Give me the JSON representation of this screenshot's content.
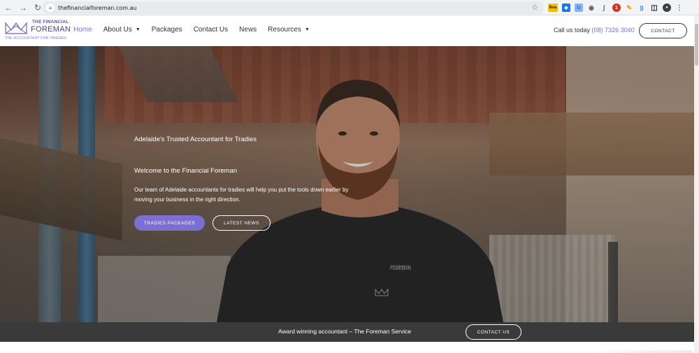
{
  "browser": {
    "url": "thefinancialforeman.com.au",
    "extensions": [
      "beta-icon",
      "tag-icon",
      "translate-icon",
      "camera-icon",
      "quill-icon",
      "red-badge-icon",
      "pencil-icon",
      "wave-icon",
      "puzzle-icon",
      "profile-avatar",
      "kebab-menu-icon"
    ],
    "beta_label": "Beta"
  },
  "logo": {
    "the": "THE FINANCIAL",
    "name": "FOREMAN",
    "tagline": "THE ACCOUNTANT FOR TRADIES"
  },
  "nav": {
    "items": [
      {
        "label": "Home",
        "active": true,
        "dropdown": false
      },
      {
        "label": "About Us",
        "active": false,
        "dropdown": true
      },
      {
        "label": "Packages",
        "active": false,
        "dropdown": false
      },
      {
        "label": "Contact Us",
        "active": false,
        "dropdown": false
      },
      {
        "label": "News",
        "active": false,
        "dropdown": false
      },
      {
        "label": "Resources",
        "active": false,
        "dropdown": true
      }
    ]
  },
  "header": {
    "call_label": "Call us today",
    "phone": "(08) 7326 3040",
    "contact_button": "CONTACT"
  },
  "hero": {
    "eyebrow": "Adelaide's Trusted Accountant for Tradies",
    "title": "Welcome to the Financial Foreman",
    "body": "Our team of Adelaide accountants for tradies will help you put the tools down earlier by moving your business in the right direction.",
    "primary_button": "TRADIES PACKAGES",
    "secondary_button": "LATEST NEWS",
    "shirt_logo_top": "THE FINANCIAL",
    "shirt_logo_bottom": "FOREMAN"
  },
  "bottom_bar": {
    "text": "Award winning accountant – The Foreman Service",
    "button": "CONTACT US"
  },
  "colors": {
    "accent": "#7b6fd4",
    "logo": "#4a4290",
    "bottom_bar": "#3a3a3a"
  }
}
